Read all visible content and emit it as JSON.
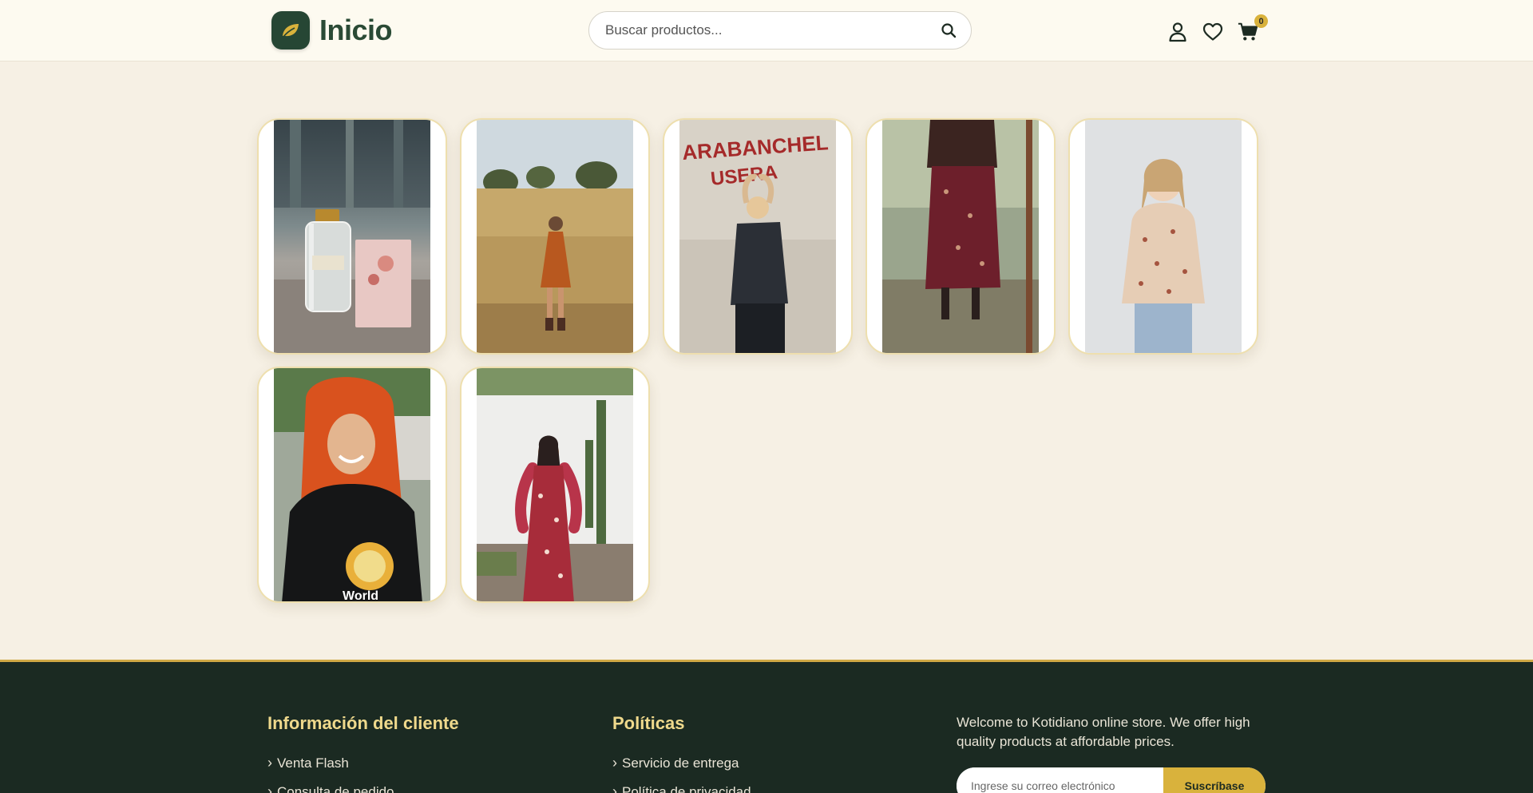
{
  "header": {
    "logo_text": "Inicio",
    "search_placeholder": "Buscar productos...",
    "cart_count": "0",
    "icons": [
      "user-icon",
      "heart-icon",
      "cart-icon",
      "search-icon",
      "leaf-icon"
    ]
  },
  "gallery": {
    "items": [
      {
        "subject": "perfume-bottle"
      },
      {
        "subject": "woman-orange-dress-field"
      },
      {
        "subject": "woman-sequin-top-wall"
      },
      {
        "subject": "floral-skirt-legs"
      },
      {
        "subject": "woman-floral-blouse"
      },
      {
        "subject": "red-hair-woman-tshirt"
      },
      {
        "subject": "woman-floral-dress-cactus"
      }
    ]
  },
  "footer": {
    "col1": {
      "title": "Información del cliente",
      "links": [
        "Venta Flash",
        "Consulta de pedido"
      ]
    },
    "col2": {
      "title": "Políticas",
      "links": [
        "Servicio de entrega",
        "Política de privacidad"
      ]
    },
    "description": "Welcome to Kotidiano online store. We offer high quality products at affordable prices.",
    "newsletter": {
      "placeholder": "Ingrese su correo electrónico",
      "button": "Suscríbase"
    }
  },
  "colors": {
    "brand_green": "#264634",
    "accent_gold": "#d9b23c",
    "footer_bg": "#1b2a22",
    "page_bg": "#f6f0e4"
  }
}
